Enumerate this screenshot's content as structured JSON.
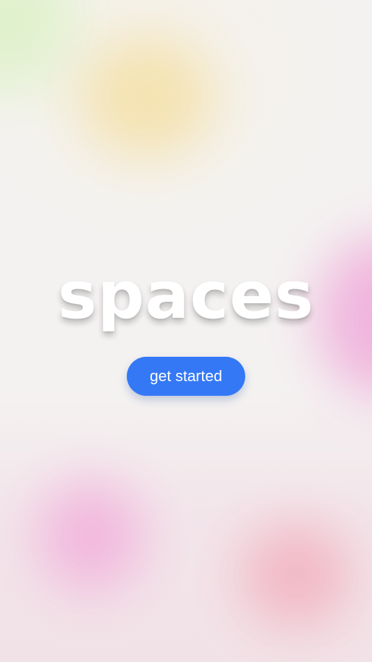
{
  "app": {
    "logo_text": "spaces"
  },
  "actions": {
    "get_started_label": "get started"
  },
  "colors": {
    "background": "#f4f2f1",
    "button": "#3478f6",
    "button_text": "#ffffff",
    "logo": "#ffffff",
    "blob_green": "#dff2cc",
    "blob_yellow": "#f4e2ae",
    "blob_pink": "#f0aedb",
    "blob_rose": "#f2b6c4"
  }
}
